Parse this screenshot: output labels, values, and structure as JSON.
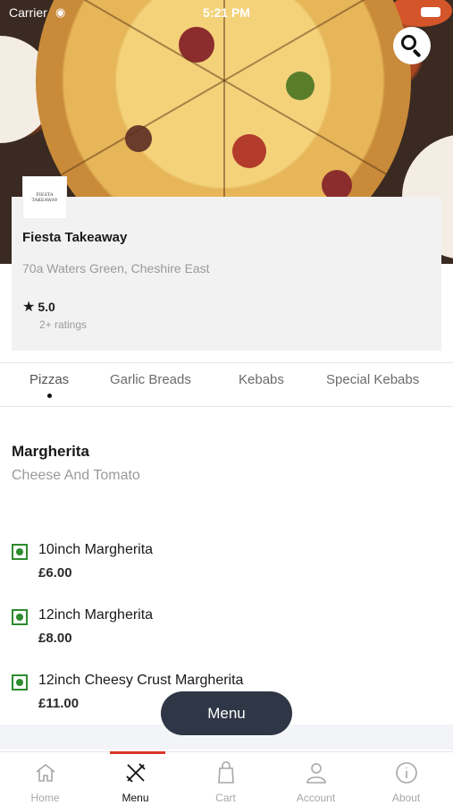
{
  "status_bar": {
    "carrier": "Carrier",
    "time": "5:21 PM"
  },
  "restaurant": {
    "logo_text": "FIESTA TAKEAWAY",
    "name": "Fiesta Takeaway",
    "address": "70a Waters Green, Cheshire East",
    "rating": "5.0",
    "rating_count": "2+ ratings"
  },
  "category_tabs": [
    {
      "label": "Pizzas",
      "active": true
    },
    {
      "label": "Garlic Breads",
      "active": false
    },
    {
      "label": "Kebabs",
      "active": false
    },
    {
      "label": "Special Kebabs",
      "active": false
    }
  ],
  "section": {
    "title": "Margherita",
    "subtitle": "Cheese And Tomato",
    "items": [
      {
        "name": "10inch Margherita",
        "price": "£6.00"
      },
      {
        "name": "12inch Margherita",
        "price": "£8.00"
      },
      {
        "name": "12inch Cheesy Crust Margherita",
        "price": "£11.00"
      }
    ]
  },
  "floating_button": {
    "label": "Menu"
  },
  "bottom_nav": [
    {
      "label": "Home",
      "icon": "home-icon",
      "active": false
    },
    {
      "label": "Menu",
      "icon": "fork-knife-icon",
      "active": true
    },
    {
      "label": "Cart",
      "icon": "shopping-bag-icon",
      "active": false
    },
    {
      "label": "Account",
      "icon": "user-icon",
      "active": false
    },
    {
      "label": "About",
      "icon": "info-icon",
      "active": false
    }
  ],
  "colors": {
    "accent": "#d9362b",
    "veg_green": "#2e8b2e",
    "floating_button": "#2f3646",
    "card_background": "#f2f2f2"
  }
}
